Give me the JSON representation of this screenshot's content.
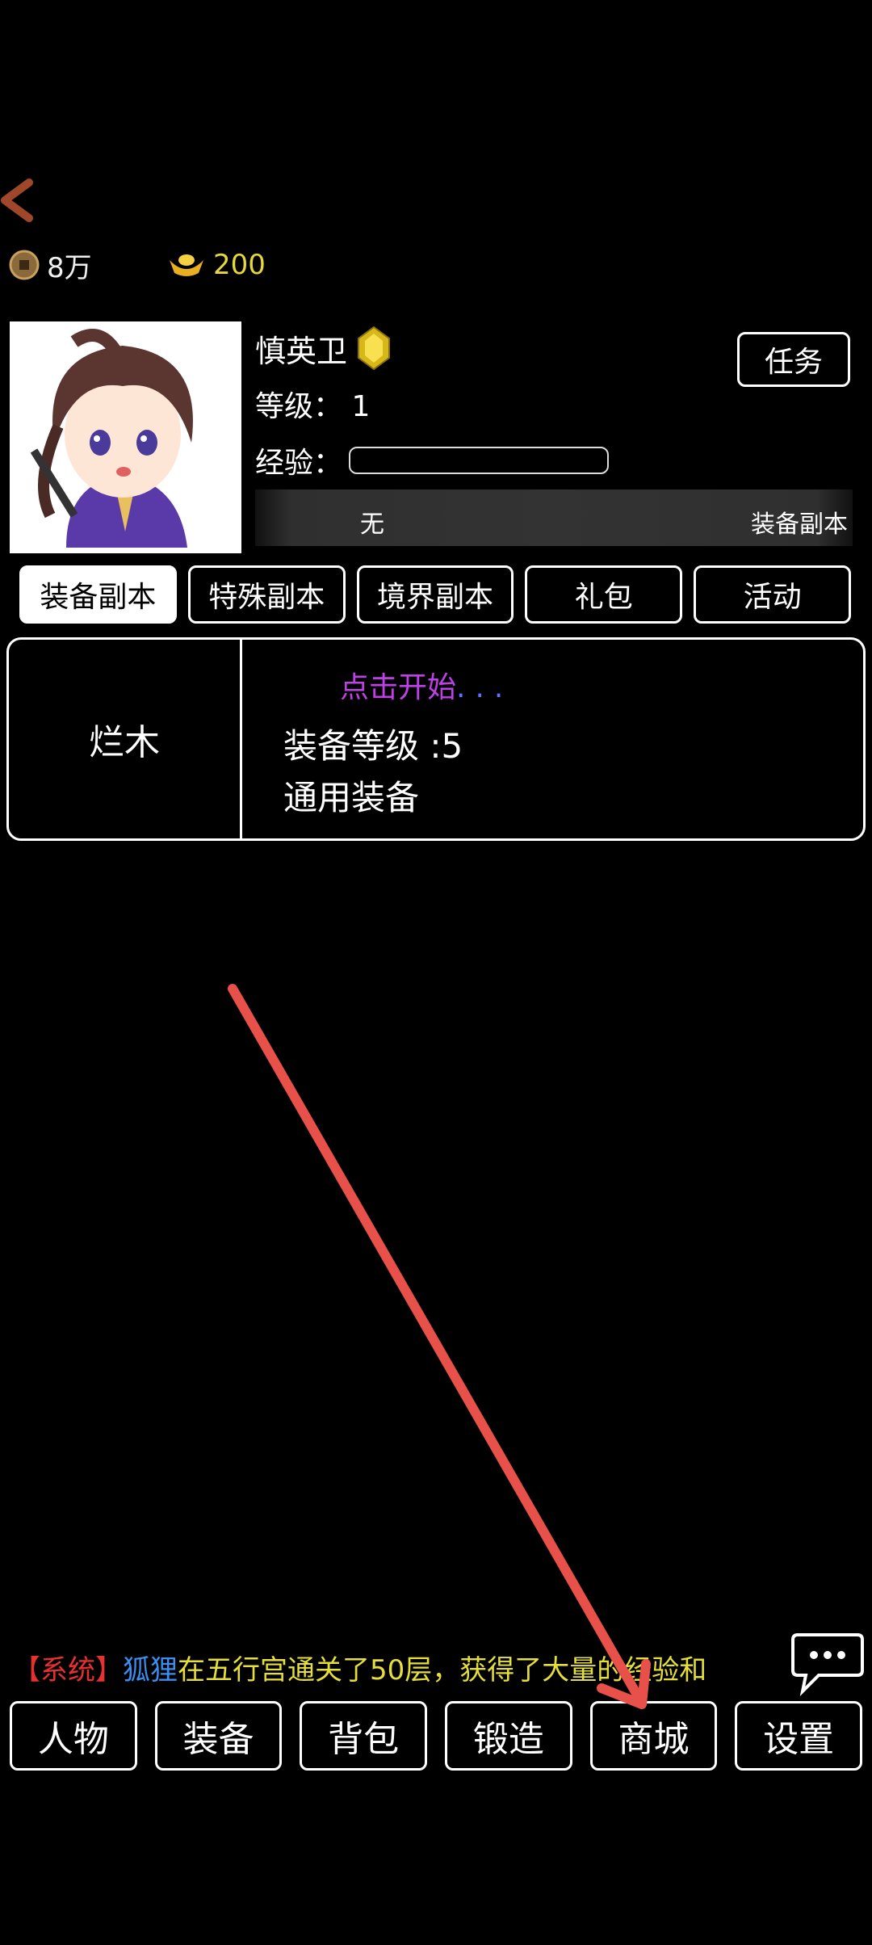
{
  "resources": {
    "coins": "8万",
    "ingots": "200"
  },
  "player": {
    "name": "慎英卫",
    "level_label": "等级：",
    "level_value": "1",
    "exp_label": "经验："
  },
  "task_button": "任务",
  "info_bar": {
    "left": "无",
    "right": "装备副本"
  },
  "tabs": [
    {
      "label": "装备副本",
      "active": true
    },
    {
      "label": "特殊副本",
      "active": false
    },
    {
      "label": "境界副本",
      "active": false
    },
    {
      "label": "礼包",
      "active": false
    },
    {
      "label": "活动",
      "active": false
    }
  ],
  "dungeon": {
    "name": "烂木",
    "start_text": "点击开始",
    "start_dots": "...",
    "equip_level": "装备等级 :5",
    "equip_type": "通用装备"
  },
  "system_message": {
    "tag": "【系统】",
    "player": "狐狸",
    "text": "在五行宫通关了50层，获得了大量的经验和"
  },
  "bottom_nav": [
    "人物",
    "装备",
    "背包",
    "锻造",
    "商城",
    "设置"
  ],
  "icons": {
    "back": "back-arrow-icon",
    "coin": "coin-icon",
    "ingot": "gold-ingot-icon",
    "rank": "gem-rank-icon",
    "chat": "chat-bubble-icon"
  },
  "colors": {
    "background": "#000000",
    "system_tag": "#e83030",
    "system_player": "#3a8ff0",
    "system_text": "#e6df3a",
    "start_text": "#c040e8",
    "annotation_arrow": "#e8504a"
  }
}
